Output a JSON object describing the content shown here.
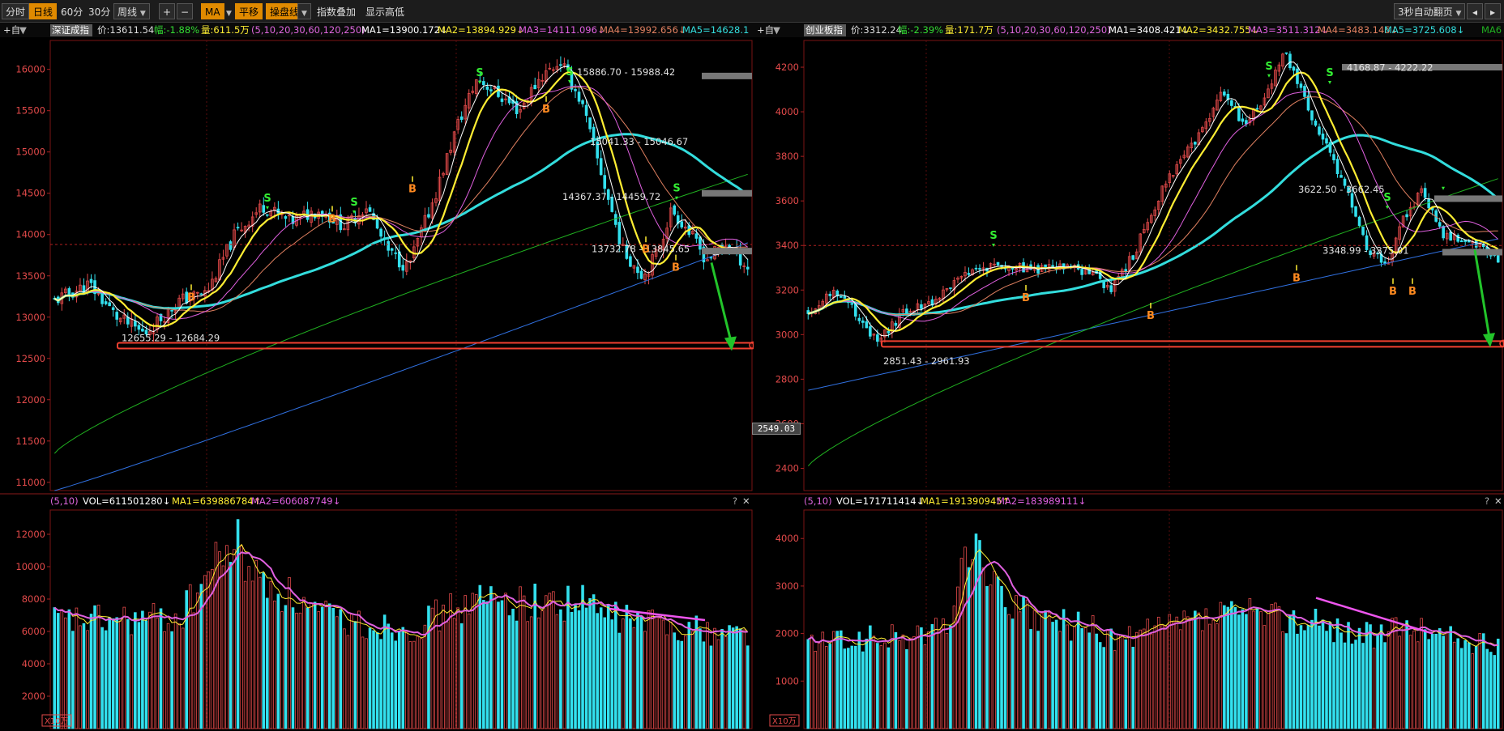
{
  "toolbar": {
    "tabs": [
      "分时",
      "日线",
      "60分",
      "30分",
      "周线"
    ],
    "active_tab": "日线",
    "zoom_in": "+",
    "zoom_out": "−",
    "indicator": "MA",
    "btn_flat": "平移",
    "btn_trend": "操盘线",
    "overlay_index": "指数叠加",
    "show_highlow": "显示高低",
    "auto_page": "3秒自动翻页"
  },
  "colors": {
    "up": "#e34a4a",
    "down": "#33e0ee",
    "ma1": "#ffffff",
    "ma2": "#ffee33",
    "ma3": "#e060e0",
    "ma4": "#e08060",
    "ma5": "#33dddd",
    "ma250": "#3070e0",
    "ma120": "#20b020",
    "arrow": "#22c42a",
    "support": "#f04030",
    "resistance": "#777777"
  },
  "panels": [
    {
      "id": "left",
      "selector": "+自",
      "index_name": "深证成指",
      "price_label": "价:13611.54",
      "change_label": "幅:-1.88%",
      "volume_label": "量:611.5万",
      "periods_label": "(5,10,20,30,60,120,250)",
      "ma_labels": [
        "MA1=13900.172↓",
        "MA2=13894.929↓",
        "MA3=14111.096↓",
        "MA4=13992.656↓",
        "MA5=14628.1"
      ],
      "price_axis": [
        "16000",
        "15500",
        "15000",
        "14500",
        "14000",
        "13500",
        "13000",
        "12500",
        "12000",
        "11500",
        "11000"
      ],
      "vol_axis": [
        "12000",
        "10000",
        "8000",
        "6000",
        "4000",
        "2000"
      ],
      "vol_unit": "X10万",
      "vol_header": "(5,10)",
      "vol_label": "VOL=611501280↓",
      "vol_ma_labels": [
        "MA1=639886784↑",
        "MA2=606087749↓"
      ],
      "annotations": [
        "15886.70 - 15988.42",
        "15041.33 - 15046.67",
        "14367.37 - 14459.72",
        "13732.78 - 13845.65",
        "12655.29 - 12684.29"
      ],
      "signals_s": [
        "S",
        "S",
        "S",
        "S",
        "S"
      ],
      "signals_b": [
        "B",
        "B",
        "B",
        "B",
        "B",
        "B"
      ],
      "ylim": [
        10900,
        16350
      ],
      "vol_lim": [
        0,
        13500
      ]
    },
    {
      "id": "right",
      "selector": "+自",
      "index_name": "创业板指",
      "price_label": "价:3312.24",
      "change_label": "幅:-2.39%",
      "volume_label": "量:171.7万",
      "periods_label": "(5,10,20,30,60,120,250)",
      "ma_labels": [
        "MA1=3408.421↓",
        "MA2=3432.755↓",
        "MA3=3511.312↓",
        "MA4=3483.146↓",
        "MA5=3725.608↓",
        "MA6"
      ],
      "price_axis": [
        "4200",
        "4000",
        "3800",
        "3600",
        "3400",
        "3200",
        "3000",
        "2800",
        "2600",
        "2400"
      ],
      "vol_axis": [
        "4000",
        "3000",
        "2000",
        "1000"
      ],
      "vol_unit": "X10万",
      "vol_header": "(5,10)",
      "vol_label": "VOL=171711414↓",
      "vol_ma_labels": [
        "MA1=191390945↑",
        "MA2=183989111↓"
      ],
      "annotations": [
        "4168.87 - 4222.22",
        "3622.50 - 3662.45",
        "3348.99 - 3375.01",
        "2851.43 - 2961.93"
      ],
      "signals_s": [
        "S",
        "S",
        "S",
        "S"
      ],
      "signals_b": [
        "B",
        "B",
        "B",
        "B",
        "B"
      ],
      "ylim": [
        2300,
        4320
      ],
      "vol_lim": [
        0,
        4600
      ]
    }
  ],
  "crosshair_price": "2549.03",
  "help_icons": "?",
  "close_icons": "✕"
}
